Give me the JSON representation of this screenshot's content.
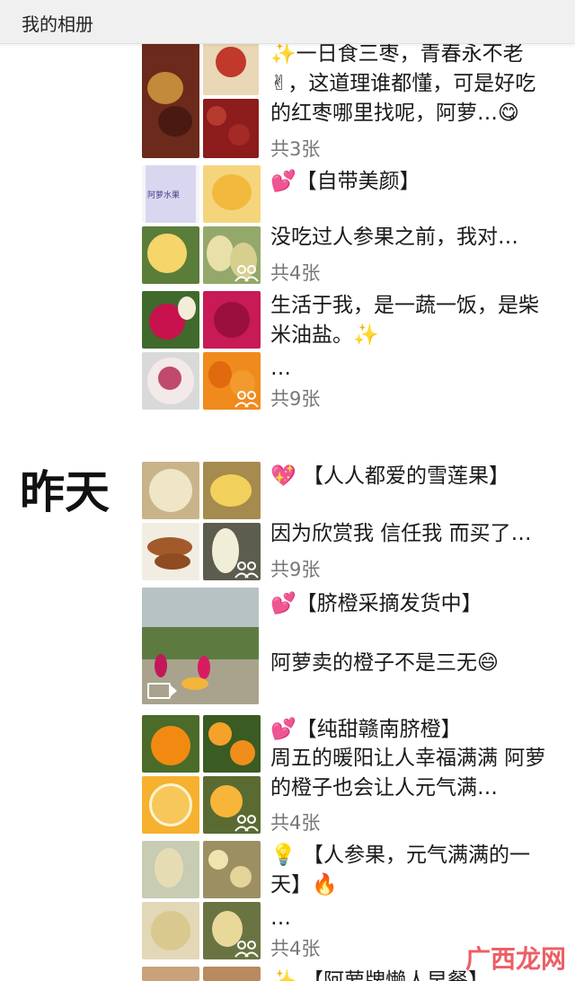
{
  "header": {
    "title": "我的相册"
  },
  "date_label": "昨天",
  "posts": [
    {
      "text": "✨一日食三枣，青春永不老✌，这道理谁都懂，可是好吃的红枣哪里找呢，阿萝…😋",
      "count": "共3张"
    },
    {
      "text1": "💕【自带美颜】",
      "text2": "没吃过人参果之前，我对…",
      "count": "共4张"
    },
    {
      "text1": "生活于我，是一蔬一饭，是柴米油盐。✨",
      "text2": "…",
      "count": "共9张"
    },
    {
      "text1": "💖 【人人都爱的雪莲果】",
      "text2": "因为欣赏我 信任我 而买了…",
      "count": "共9张"
    },
    {
      "text1": "💕【脐橙采摘发货中】",
      "text2": "阿萝卖的橙子不是三无😄"
    },
    {
      "text1": "💕【纯甜赣南脐橙】",
      "text2": "周五的暖阳让人幸福满满 阿萝的橙子也会让人元气满…",
      "count": "共4张"
    },
    {
      "text1": "💡 【人参果，元气满满的一天】🔥",
      "text2": "…",
      "count": "共4张"
    },
    {
      "text1": "✨ 【阿萝牌懒人早餐】"
    }
  ],
  "thumb_labels": {
    "ginseng_box": "阿萝水果"
  },
  "watermark": "广西龙网",
  "colors": {
    "header_bg": "#f0f0f0",
    "text": "#1a1a1a",
    "count": "#777777"
  }
}
